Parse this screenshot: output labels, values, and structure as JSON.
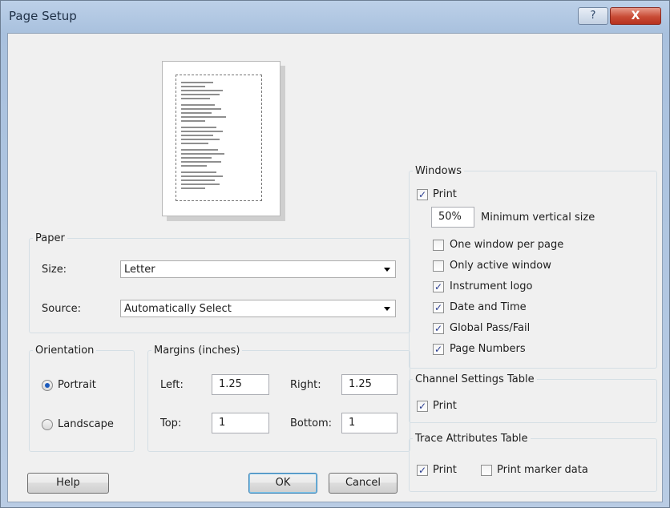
{
  "window": {
    "title": "Page Setup",
    "help_glyph": "?",
    "close_glyph": "X"
  },
  "paper": {
    "legend": "Paper",
    "size_label": "Size:",
    "size_value": "Letter",
    "source_label": "Source:",
    "source_value": "Automatically Select"
  },
  "orientation": {
    "legend": "Orientation",
    "portrait_label": "Portrait",
    "landscape_label": "Landscape",
    "selected": "Portrait"
  },
  "margins": {
    "legend": "Margins (inches)",
    "left_label": "Left:",
    "left_value": "1.25",
    "right_label": "Right:",
    "right_value": "1.25",
    "top_label": "Top:",
    "top_value": "1",
    "bottom_label": "Bottom:",
    "bottom_value": "1"
  },
  "windows": {
    "legend": "Windows",
    "print_label": "Print",
    "print_checked": true,
    "min_size_value": "50%",
    "min_size_label": "Minimum vertical size",
    "one_window_label": "One window per page",
    "one_window_checked": false,
    "only_active_label": "Only active window",
    "only_active_checked": false,
    "instrument_logo_label": "Instrument logo",
    "instrument_logo_checked": true,
    "date_time_label": "Date and Time",
    "date_time_checked": true,
    "global_pass_fail_label": "Global Pass/Fail",
    "global_pass_fail_checked": true,
    "page_numbers_label": "Page Numbers",
    "page_numbers_checked": true
  },
  "channel_settings": {
    "legend": "Channel Settings Table",
    "print_label": "Print",
    "print_checked": true
  },
  "trace_attributes": {
    "legend": "Trace Attributes Table",
    "print_label": "Print",
    "print_checked": true,
    "marker_label": "Print marker data",
    "marker_checked": false
  },
  "buttons": {
    "help": "Help",
    "ok": "OK",
    "cancel": "Cancel"
  },
  "check_glyph": "✓"
}
